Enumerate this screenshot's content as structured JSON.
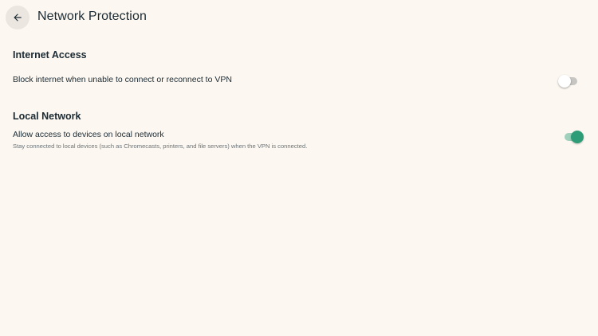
{
  "header": {
    "title": "Network Protection",
    "back_icon": "arrow-left-icon"
  },
  "sections": [
    {
      "title": "Internet Access",
      "rows": [
        {
          "label": "Block internet when unable to connect or reconnect to VPN",
          "description": "",
          "toggle_on": false
        }
      ]
    },
    {
      "title": "Local Network",
      "rows": [
        {
          "label": "Allow access to devices on local network",
          "description": "Stay connected to local devices (such as Chromecasts, printers, and file servers) when the VPN is connected.",
          "toggle_on": true
        }
      ]
    }
  ],
  "colors": {
    "background": "#fcf8f1",
    "text": "#1c2a33",
    "accent": "#2e9c77",
    "accent_track": "#9fd1bd"
  }
}
